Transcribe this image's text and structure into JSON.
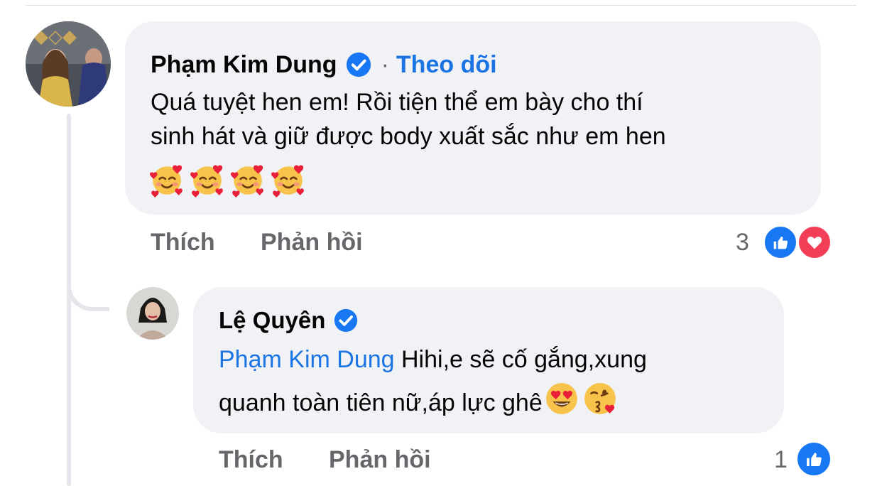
{
  "comment": {
    "author": "Phạm Kim Dung",
    "follow_separator": "·",
    "follow_label": "Theo dõi",
    "text_line1": "Quá tuyệt hen em! Rồi tiện thể em bày cho thí",
    "text_line2": "sinh hát và giữ được body xuất sắc như em hen",
    "emojis": [
      "smiling-face-with-hearts",
      "smiling-face-with-hearts",
      "smiling-face-with-hearts",
      "smiling-face-with-hearts"
    ],
    "like_label": "Thích",
    "reply_label": "Phản hồi",
    "reaction_count": "3",
    "reactions": [
      "like",
      "love"
    ]
  },
  "reply": {
    "author": "Lệ Quyên",
    "mention": "Phạm Kim Dung",
    "text_line1": " Hihi,e sẽ cố gắng,xung",
    "text_line2": "quanh toàn tiên nữ,áp lực ghê",
    "emojis": [
      "heart-eyes",
      "face-blowing-kiss"
    ],
    "like_label": "Thích",
    "reply_label": "Phản hồi",
    "reaction_count": "1",
    "reactions": [
      "like"
    ]
  },
  "colors": {
    "bubble": "#f0f2f5",
    "link_blue": "#1b74e4",
    "muted_text": "#65676b",
    "like_blue": "#1877f2",
    "love_red": "#f33e58"
  }
}
